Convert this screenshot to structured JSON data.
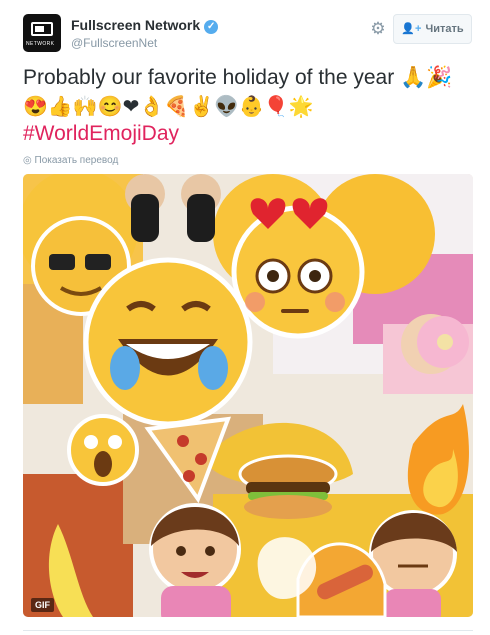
{
  "account": {
    "name": "Fullscreen Network",
    "handle": "@FullscreenNet",
    "avatar_text": "NETWORK",
    "verified_icon": "verified-badge-icon"
  },
  "actions": {
    "follow_label": "Читать",
    "follow_icon": "add-user-icon",
    "settings_icon": "gear-icon"
  },
  "tweet": {
    "text": "Probably our favorite holiday of the year 🙏🎉",
    "emojis": "😍👍🙌😊❤👌🍕✌👽👶🎈🌟",
    "hashtag": "#WorldEmojiDay",
    "translate_label": "Показать перевод",
    "translate_icon": "globe-icon"
  },
  "media": {
    "badge": "GIF",
    "description_icon": "emoji-collage-image"
  },
  "colors": {
    "hashtag": "#e0245e",
    "verified": "#55acee",
    "muted": "#8899a6"
  }
}
